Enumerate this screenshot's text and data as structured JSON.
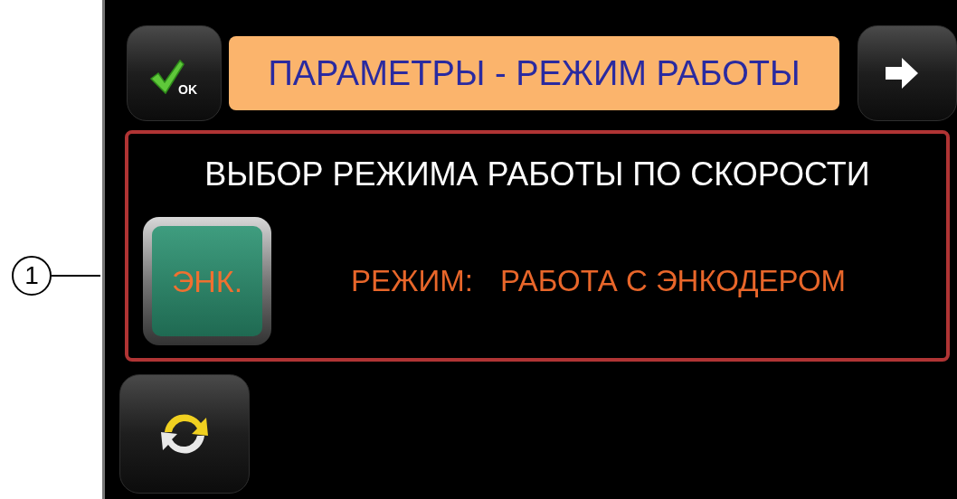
{
  "callout": {
    "label": "1"
  },
  "top_bar": {
    "ok_button": {
      "label": "OK"
    },
    "title": "ПАРАМЕТРЫ - РЕЖИМ РАБОТЫ"
  },
  "speed_mode_panel": {
    "heading": "ВЫБОР РЕЖИМА РАБОТЫ ПО СКОРОСТИ",
    "mode_button": {
      "label": "ЭНК."
    },
    "mode_label": "РЕЖИМ:",
    "mode_value": "РАБОТА С ЭНКОДЕРОМ"
  }
}
